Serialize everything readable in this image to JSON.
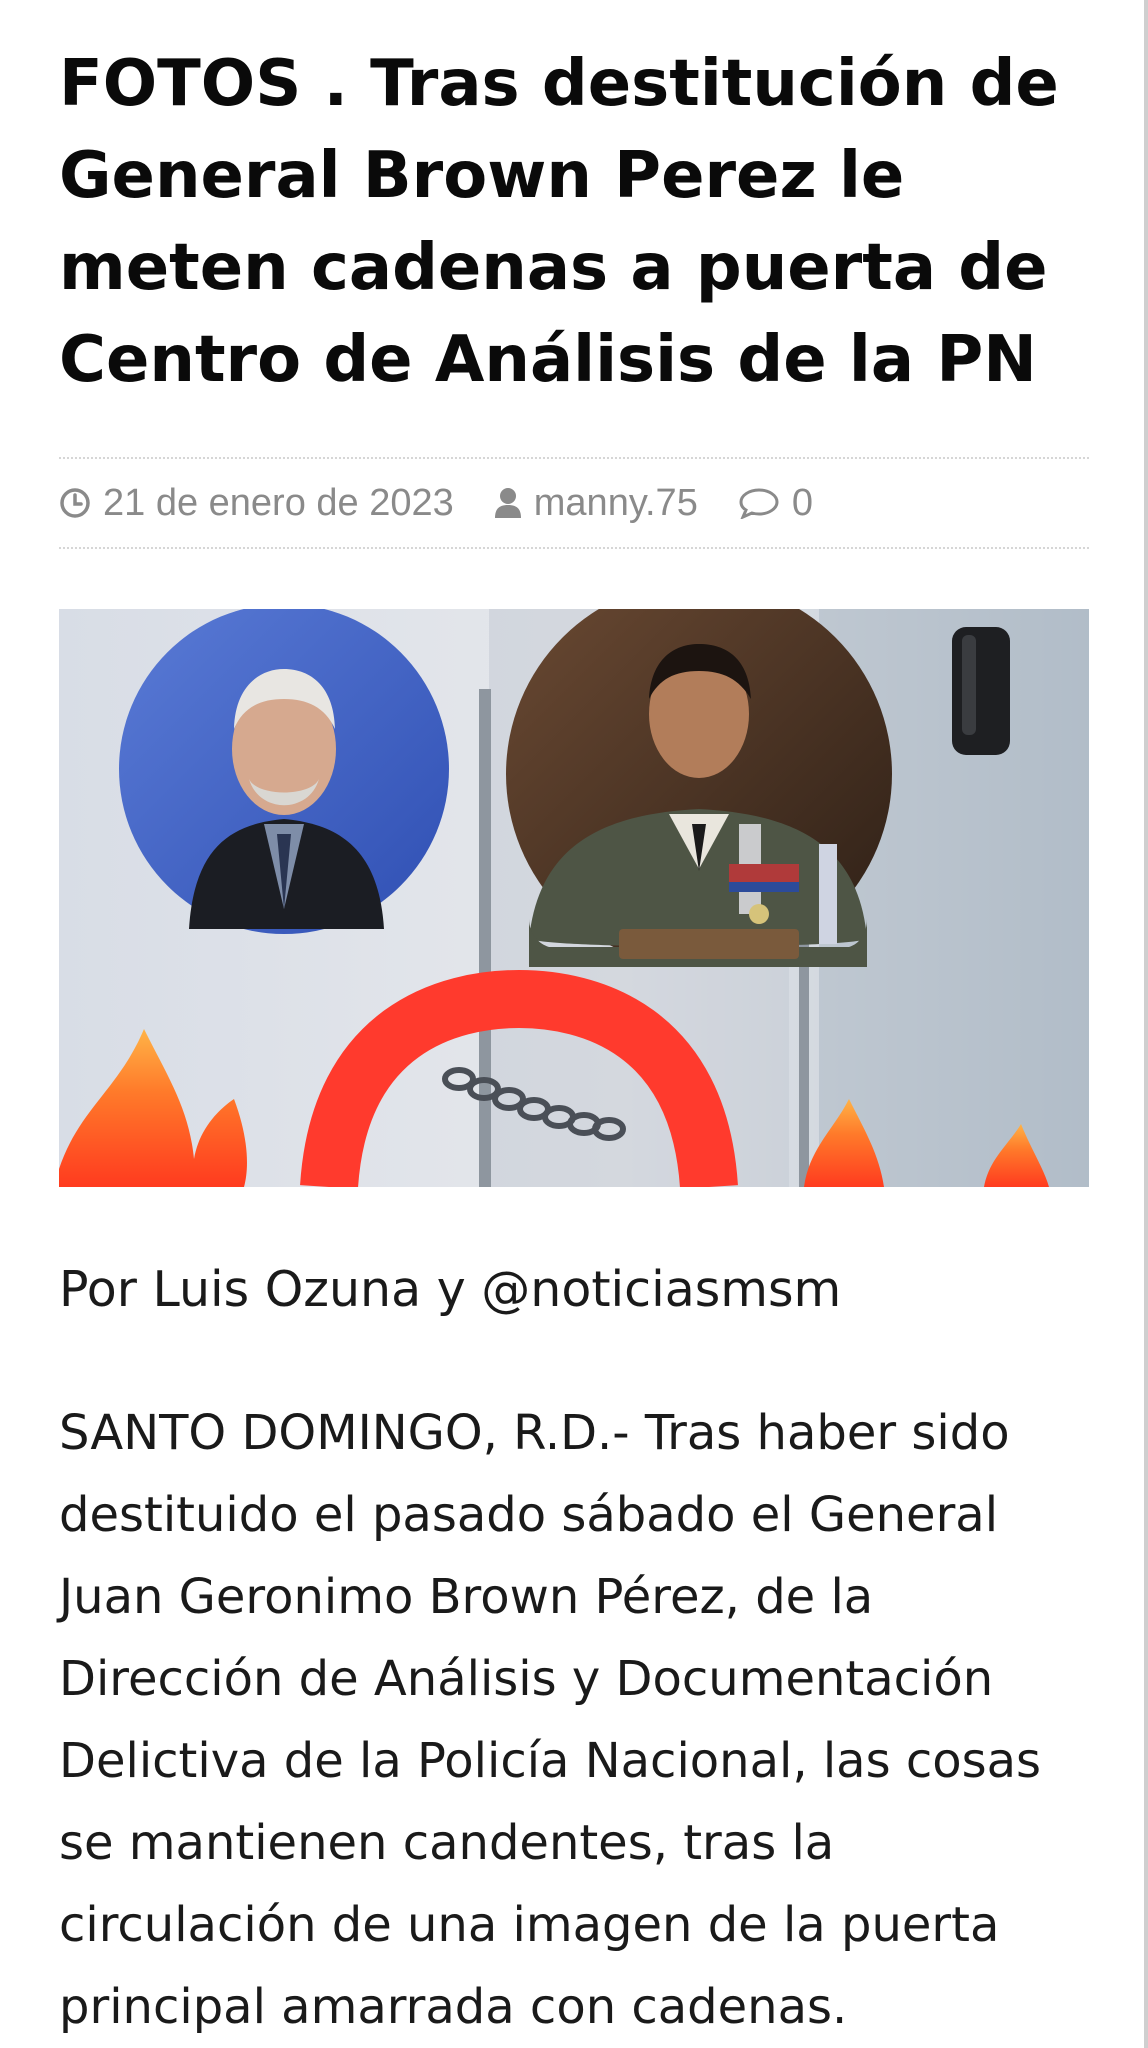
{
  "article": {
    "title": "FOTOS . Tras destitución de General Brown Perez le meten cadenas a puerta de Centro de Análisis de la PN",
    "meta": {
      "date": "21 de enero de 2023",
      "author": "manny.75",
      "comments": "0"
    },
    "image": {
      "icon": "news-photo"
    },
    "byline": "Por Luis Ozuna y @noticiasmsm",
    "paragraph": "SANTO DOMINGO, R.D.- Tras haber sido destituido el pasado sábado el General Juan Geronimo Brown Pérez, de la Dirección de Análisis y Documentación Delictiva de la Policía Nacional, las cosas se mantienen candentes, tras la circulación de una imagen de la puerta principal amarrada con cadenas."
  },
  "colors": {
    "meta_text": "#8a8a8a",
    "title_text": "#0a0a0a",
    "body_text": "#1a1a1a",
    "flame": "#ff5a1f"
  }
}
